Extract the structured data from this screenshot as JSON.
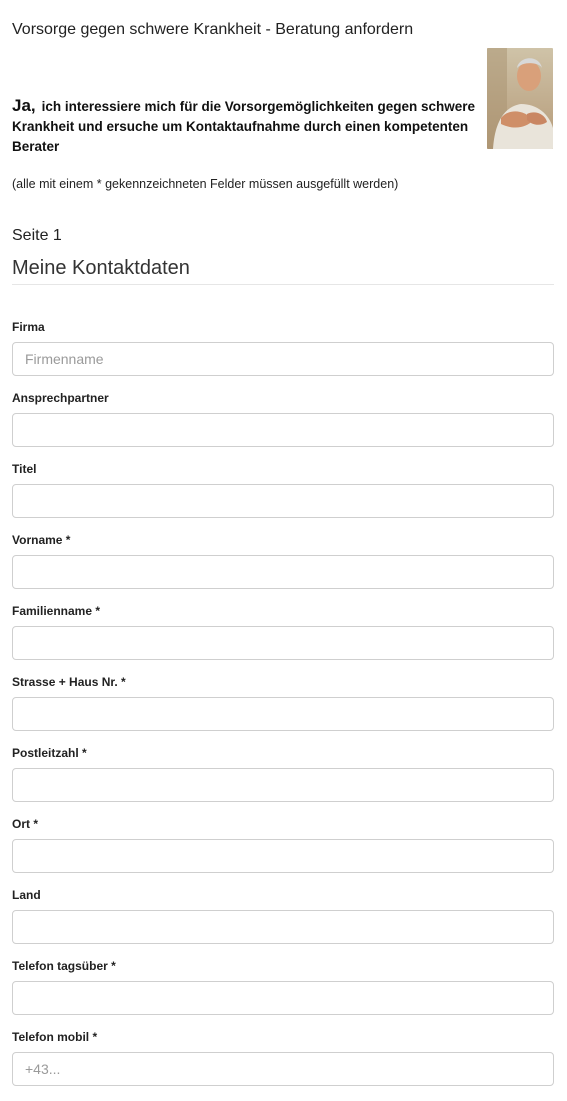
{
  "header": {
    "title": "Vorsorge gegen schwere Krankheit - Beratung anfordern"
  },
  "intro": {
    "ja": "Ja,",
    "text": "ich interessiere mich für die Vorsorgemöglichkeiten gegen schwere Krankheit und ersuche um Kontaktaufnahme durch einen kompetenten Berater"
  },
  "note": "(alle mit einem * gekennzeichneten Felder müssen ausgefüllt werden)",
  "page_label": "Seite 1",
  "section_title": "Meine Kontaktdaten",
  "fields": [
    {
      "label": "Firma",
      "placeholder": "Firmenname",
      "value": ""
    },
    {
      "label": "Ansprechpartner",
      "placeholder": "",
      "value": ""
    },
    {
      "label": "Titel",
      "placeholder": "",
      "value": ""
    },
    {
      "label": "Vorname *",
      "placeholder": "",
      "value": ""
    },
    {
      "label": "Familienname *",
      "placeholder": "",
      "value": ""
    },
    {
      "label": "Strasse + Haus Nr. *",
      "placeholder": "",
      "value": ""
    },
    {
      "label": "Postleitzahl *",
      "placeholder": "",
      "value": ""
    },
    {
      "label": "Ort *",
      "placeholder": "",
      "value": ""
    },
    {
      "label": "Land",
      "placeholder": "",
      "value": ""
    },
    {
      "label": "Telefon tagsüber *",
      "placeholder": "",
      "value": ""
    },
    {
      "label": "Telefon mobil *",
      "placeholder": "+43...",
      "value": ""
    }
  ]
}
